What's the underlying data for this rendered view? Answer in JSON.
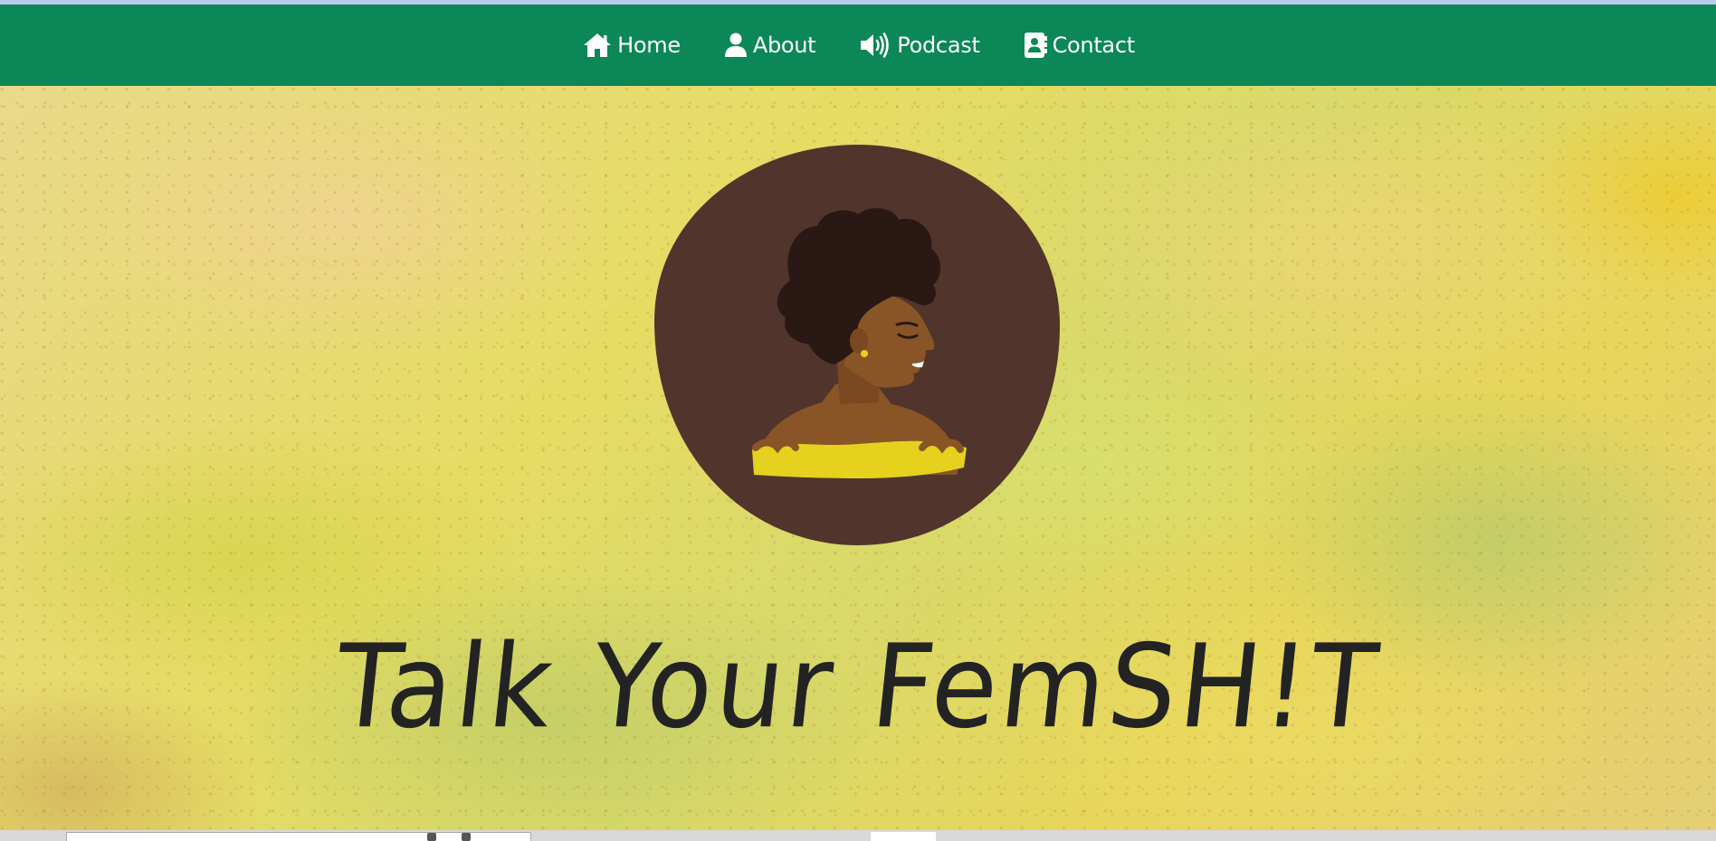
{
  "nav": {
    "items": [
      {
        "label": "Home",
        "icon": "home-icon"
      },
      {
        "label": "About",
        "icon": "user-icon"
      },
      {
        "label": "Podcast",
        "icon": "speaker-icon"
      },
      {
        "label": "Contact",
        "icon": "contact-card-icon"
      }
    ]
  },
  "hero": {
    "title": "Talk Your FemSH!T",
    "avatar": "woman-profile-illustration"
  },
  "colors": {
    "nav_background": "#0c8757",
    "nav_text": "#ffffff",
    "title_text": "#232323",
    "avatar_circle": "#51352c",
    "hair": "#2a1814",
    "skin": "#8a5526",
    "top": "#e6d11f"
  }
}
